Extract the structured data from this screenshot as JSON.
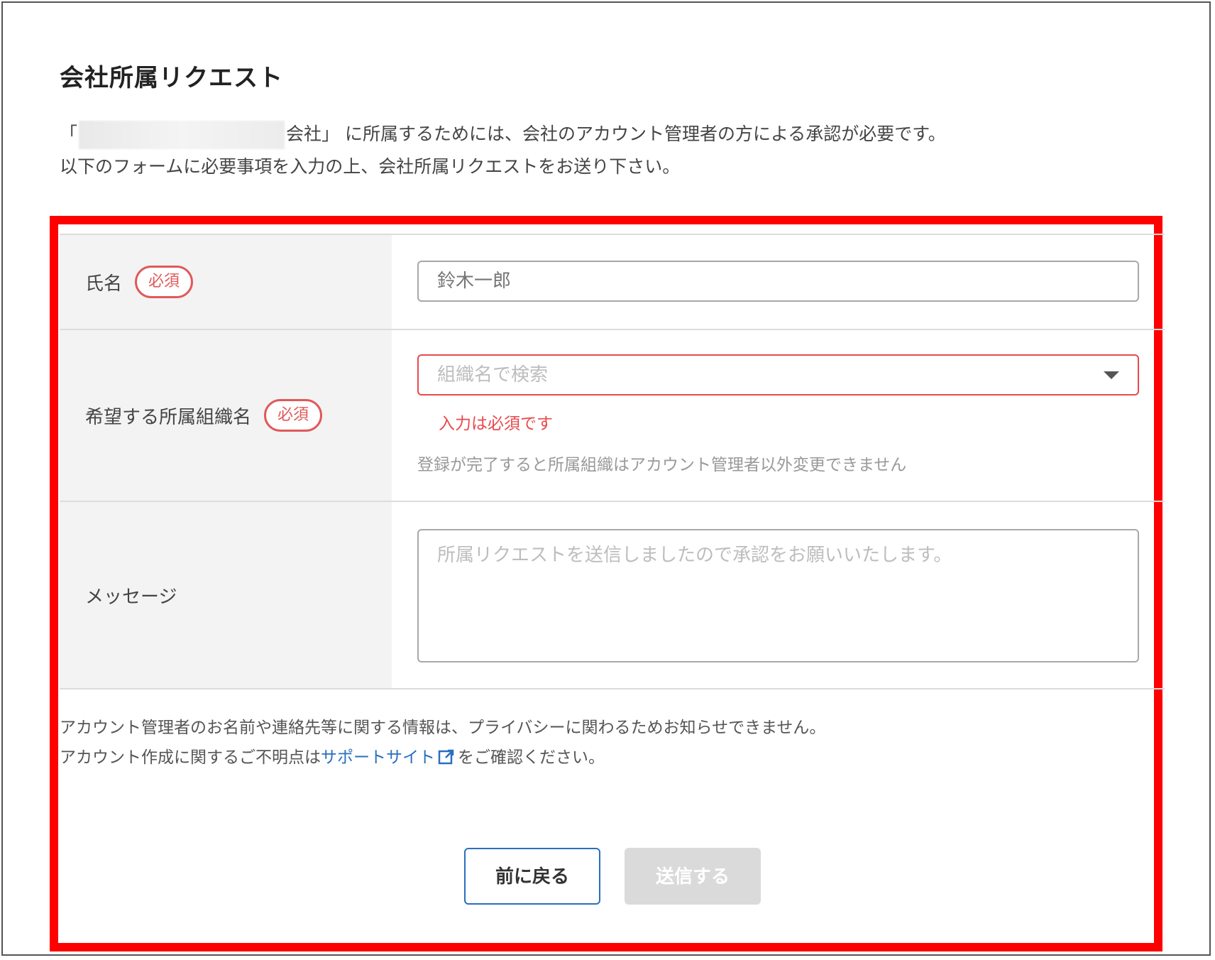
{
  "page": {
    "title": "会社所属リクエスト",
    "intro_open_bracket": "「",
    "intro_company_suffix": "会社」",
    "intro_line1_rest": " に所属するためには、会社のアカウント管理者の方による承認が必要です。",
    "intro_line2": "以下のフォームに必要事項を入力の上、会社所属リクエストをお送り下さい。"
  },
  "form": {
    "name": {
      "label": "氏名",
      "badge": "必須",
      "placeholder": "鈴木一郎"
    },
    "org": {
      "label": "希望する所属組織名",
      "badge": "必須",
      "placeholder": "組織名で検索",
      "error": "入力は必須です",
      "help": "登録が完了すると所属組織はアカウント管理者以外変更できません"
    },
    "message": {
      "label": "メッセージ",
      "placeholder": "所属リクエストを送信しましたので承認をお願いいたします。"
    }
  },
  "notes": {
    "line1": "アカウント管理者のお名前や連絡先等に関する情報は、プライバシーに関わるためお知らせできません。",
    "line2_prefix": "アカウント作成に関するご不明点は",
    "line2_link": "サポートサイト",
    "line2_suffix": "をご確認ください。"
  },
  "buttons": {
    "back": "前に戻る",
    "send": "送信する"
  },
  "colors": {
    "required": "#e0595b",
    "error": "#e9494b",
    "link": "#2a6fbf",
    "highlight": "#ff0000"
  },
  "icons": {
    "external_link": "external-link-icon",
    "dropdown": "chevron-down-icon"
  }
}
